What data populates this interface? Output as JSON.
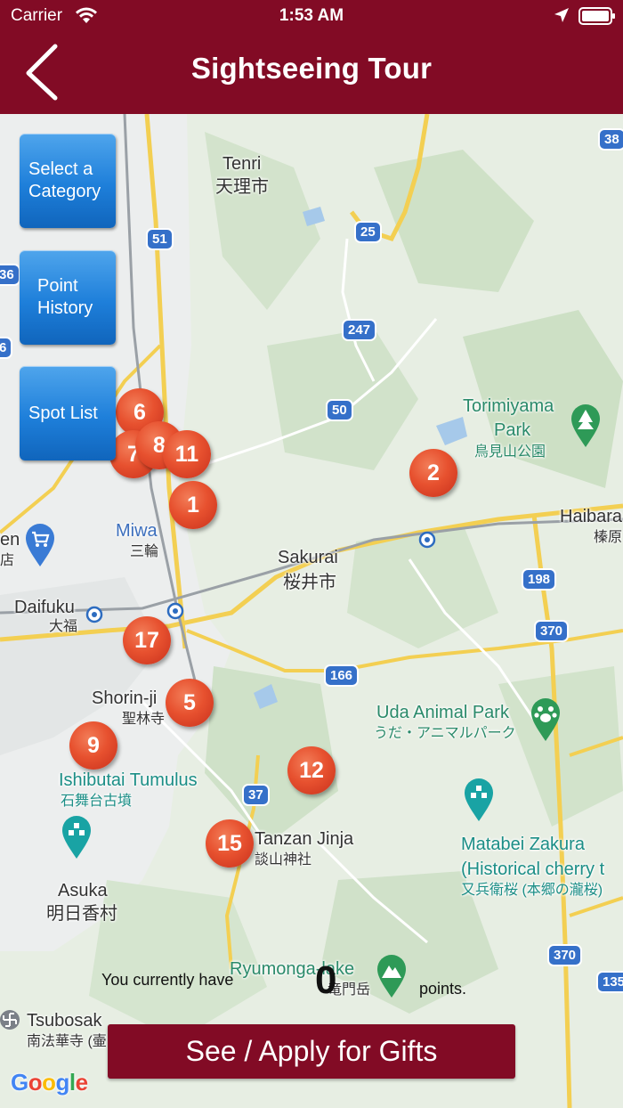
{
  "status_bar": {
    "carrier": "Carrier",
    "time": "1:53 AM"
  },
  "header": {
    "title": "Sightseeing Tour"
  },
  "side_buttons": {
    "category": "Select a Category",
    "history": "Point History",
    "spots": "Spot List"
  },
  "map": {
    "places": {
      "tenri_en": "Tenri",
      "tenri_jp": "天理市",
      "torimiyama_en": "Torimiyama",
      "torimiyama_park": "Park",
      "torimiyama_jp": "鳥見山公園",
      "haibara_en": "Haibara",
      "haibara_jp": "榛原",
      "miwa_en": "Miwa",
      "miwa_jp": "三輪",
      "sakurai_en": "Sakurai",
      "sakurai_jp": "桜井市",
      "daifuku_en": "Daifuku",
      "daifuku_jp": "大福",
      "shorinji_en": "Shorin-ji",
      "shorinji_jp": "聖林寺",
      "uda_en": "Uda Animal Park",
      "uda_jp": "うだ・アニマルパーク",
      "ishibutai_en": "Ishibutai Tumulus",
      "ishibutai_jp": "石舞台古墳",
      "tanzan_en": "Tanzan Jinja",
      "tanzan_jp": "談山神社",
      "matabei_en": "Matabei Zakura",
      "matabei_sub": "(Historical cherry t",
      "matabei_jp": "又兵衛桜 (本郷の瀧桜)",
      "asuka_en": "Asuka",
      "asuka_jp": "明日香村",
      "ryumon_en": "Ryumonga-lake",
      "ryumon_jp": "竜門岳",
      "tsubosaka_en": "Tsubosak",
      "tsubosaka_jp": "南法華寺 (壷",
      "left_en": "en",
      "left_jp": "店"
    },
    "roads": [
      "38",
      "25",
      "51",
      "36",
      "247",
      "6",
      "50",
      "198",
      "370",
      "166",
      "37",
      "370",
      "135"
    ],
    "pins": [
      "6",
      "7",
      "8",
      "11",
      "1",
      "2",
      "17",
      "5",
      "9",
      "12",
      "15"
    ]
  },
  "points": {
    "label": "You currently have",
    "value": "0",
    "unit": "points."
  },
  "gift_button": "See / Apply for Gifts",
  "attribution": "Google"
}
